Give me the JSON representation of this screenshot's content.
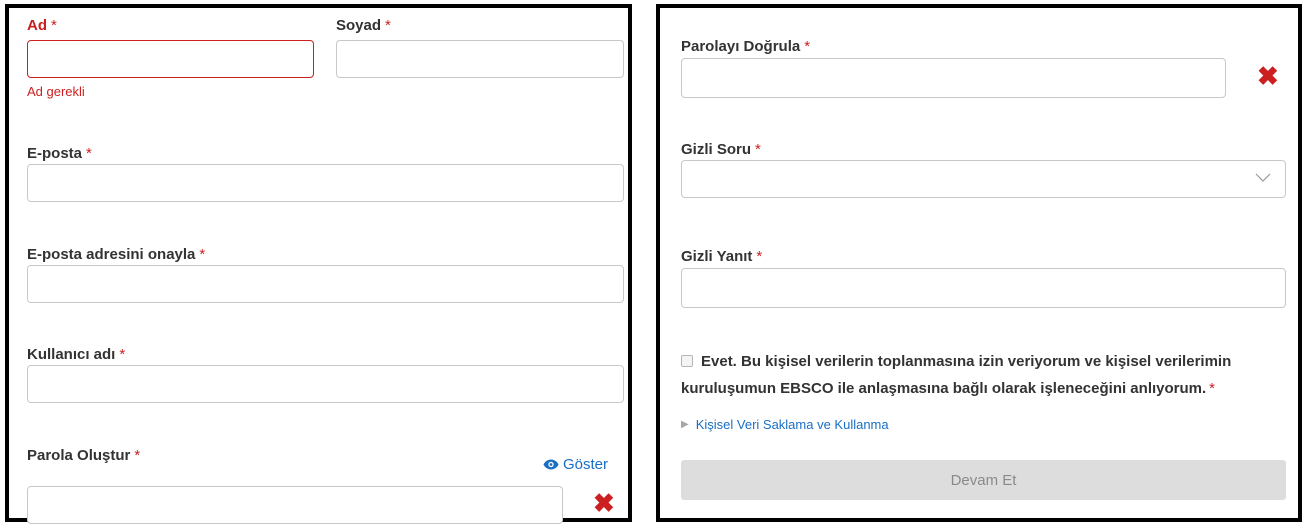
{
  "left_form": {
    "first_name": {
      "label": "Ad",
      "required_mark": "*",
      "value": "",
      "error": "Ad gerekli"
    },
    "last_name": {
      "label": "Soyad",
      "required_mark": "*",
      "value": ""
    },
    "email": {
      "label": "E-posta",
      "required_mark": "*",
      "value": ""
    },
    "confirm_email": {
      "label": "E-posta adresini onayla",
      "required_mark": "*",
      "value": ""
    },
    "username": {
      "label": "Kullanıcı adı",
      "required_mark": "*",
      "value": ""
    },
    "password": {
      "label": "Parola Oluştur",
      "required_mark": "*",
      "value": "",
      "show_label": "Göster"
    }
  },
  "right_form": {
    "confirm_password": {
      "label": "Parolayı Doğrula",
      "required_mark": "*",
      "value": ""
    },
    "secret_question": {
      "label": "Gizli Soru",
      "required_mark": "*",
      "selected": ""
    },
    "secret_answer": {
      "label": "Gizli Yanıt",
      "required_mark": "*",
      "value": ""
    },
    "consent": {
      "text": "Evet. Bu kişisel verilerin toplanmasına izin veriyorum ve kişisel verilerimin kuruluşumun EBSCO ile anlaşmasına bağlı olarak işleneceğini anlıyorum.",
      "required_mark": "*",
      "checked": false
    },
    "disclosure_link": "Kişisel Veri Saklama ve Kullanma",
    "continue_button": "Devam Et"
  },
  "colors": {
    "error": "#cc1f1f",
    "link": "#1a6fc4",
    "button_disabled_bg": "#dddddd"
  },
  "icons": {
    "invalid": "x-icon",
    "show_password": "eye-icon",
    "select_arrow": "chevron-down-icon",
    "disclosure": "triangle-right-icon"
  }
}
